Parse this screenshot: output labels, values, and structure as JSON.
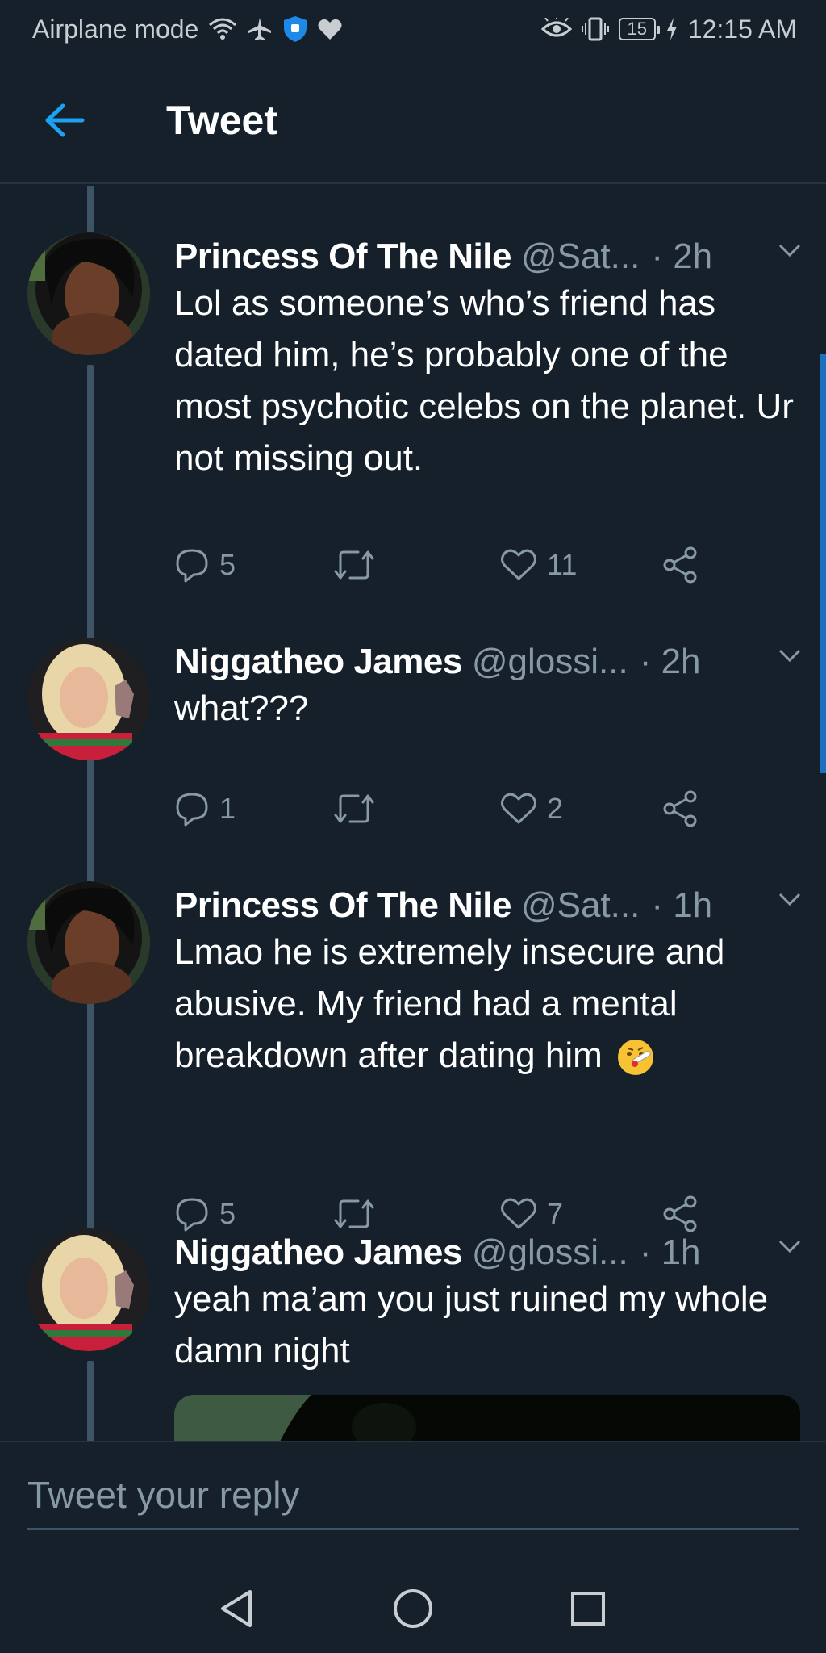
{
  "status_bar": {
    "left_text": "Airplane mode",
    "battery": "15",
    "time": "12:15 AM"
  },
  "header": {
    "title": "Tweet",
    "back_icon": "arrow-left-icon"
  },
  "tweets": [
    {
      "name": "Princess Of The Nile",
      "handle": "@Sat...",
      "time": "· 2h",
      "text": "Lol as someone’s who’s friend has dated him, he’s probably one of the most psychotic celebs on the planet. Ur not missing out.",
      "replies": "5",
      "retweets": "",
      "likes": "11"
    },
    {
      "name": "Niggatheo James",
      "handle": "@glossi...",
      "time": "· 2h",
      "text": "what???",
      "replies": "1",
      "retweets": "",
      "likes": "2"
    },
    {
      "name": "Princess Of The Nile",
      "handle": "@Sat...",
      "time": "· 1h",
      "text": "Lmao he is extremely insecure and abusive. My friend had a mental breakdown after dating him",
      "emoji": "face-with-thermometer",
      "replies": "5",
      "retweets": "",
      "likes": "7"
    },
    {
      "name": "Niggatheo James",
      "handle": "@glossi...",
      "time": "· 1h",
      "text": "yeah ma’am you just ruined my whole damn night"
    }
  ],
  "reply_bar": {
    "placeholder": "Tweet your reply"
  },
  "colors": {
    "background": "#15202b",
    "accent": "#1da1f2",
    "muted": "#8899a6",
    "divider": "#253341"
  }
}
